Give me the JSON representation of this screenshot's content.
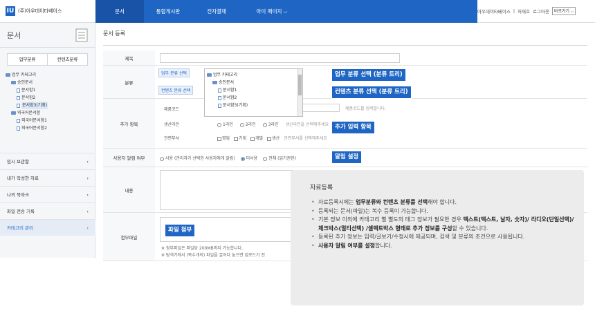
{
  "header": {
    "logo_mark": "IU",
    "logo_text": "(주)아우데이타베이스",
    "nav": [
      "문서",
      "통합게시판",
      "전자결재",
      "마이 페이지 ⌵"
    ],
    "user_company": "아우데이타베이스",
    "user_name": "허재호",
    "logout": "로그아웃",
    "shortcut_select": "바로가기 ⌵"
  },
  "sidebar": {
    "title": "문서",
    "tabs": [
      "업무분류",
      "컨텐츠분류"
    ],
    "tree": [
      {
        "label": "업무 카테고리",
        "type": "folder",
        "indent": 0
      },
      {
        "label": "승인문서",
        "type": "folder",
        "indent": 1
      },
      {
        "label": "문서함1",
        "type": "doc",
        "indent": 2
      },
      {
        "label": "문서함2",
        "type": "doc",
        "indent": 2
      },
      {
        "label": "문서함3(기획)",
        "type": "doc",
        "indent": 2,
        "selected": true
      },
      {
        "label": "외국어문서함",
        "type": "folder",
        "indent": 1
      },
      {
        "label": "외국어문서함1",
        "type": "doc",
        "indent": 2
      },
      {
        "label": "외국어문서함2",
        "type": "doc",
        "indent": 2
      }
    ],
    "menu": [
      "임시 보관함",
      "내가 작성한 자료",
      "나의 북마크",
      "파일 전송 기록",
      "카테고리 관리"
    ]
  },
  "form": {
    "page_title": "문서 등록",
    "labels": {
      "title": "제목",
      "category": "분류",
      "extra": "추가 항목",
      "alarm": "사용자 알림 여부",
      "content": "내용",
      "attach": "첨부파일"
    },
    "category_buttons": [
      "업무 분류 선택",
      "컨텐츠 분류 선택"
    ],
    "category_tree": [
      "업무 카테고리",
      "승인문서",
      "문서함1",
      "문서함2",
      "문서함3(기획)"
    ],
    "extra_fields": {
      "product_code_label": "제품코드",
      "product_code_hint": "제품코드를 입력합니다.",
      "line_label": "생산라인",
      "line_options": [
        "1라인",
        "2라인",
        "3라인"
      ],
      "line_hint": "생산라인을 선택해주세요",
      "dept_label": "관련부서",
      "dept_options": [
        "영업",
        "기획",
        "개발",
        "생산"
      ],
      "dept_hint": "관련부서를 선택해주세요"
    },
    "alarm_options": [
      "사용 (관리자가 선택한 사용자에게 알림)",
      "미사용",
      "전체 (읽기권한)"
    ],
    "attach_notes": [
      "※ 첨부파일은 파일당 200MB까지 가능합니다.",
      "※ 탐색기에서 (복수개의) 파일을 끌어다 놓으면 업로드가 진"
    ]
  },
  "callouts": {
    "cat_tree": "업무 분류 선택 (분류 트리)",
    "content_tree": "컨텐츠 분류 선택 (분류 트리)",
    "extra": "추가 입력 항목",
    "alarm": "알림 설정",
    "attach": "파일 첨부"
  },
  "popup": {
    "title": "자료등록",
    "items": [
      {
        "pre": "자료등록시에는 ",
        "bold": "업무분류와 컨텐츠 분류를 선택",
        "post": "해야 합니다."
      },
      {
        "pre": "등록되는 문서(파일)는 복수 등록이 가능합니다.",
        "bold": "",
        "post": ""
      },
      {
        "pre": "기본 정보 이외에 카테고리 별 별도의 태그 정보가 필요한 경우 ",
        "bold": "텍스트(텍스트, 날자, 숫자)/ 라디오(단일선택)/ 체크박스(멀티선택) /셀렉트박스 형태로 추가 정보를 구성",
        "post": "할 수 있습니다."
      },
      {
        "pre": "등록된 추가 정보는 입력/글보기/수정시에 제공되며, 검색 및 분류의 조건으로 사용됩니다.",
        "bold": "",
        "post": ""
      },
      {
        "pre": "",
        "bold": "사용자 알림 여부를 설정",
        "post": "합니다."
      }
    ]
  },
  "colors": {
    "accent": "#1f66c4",
    "callout": "#1f66c4",
    "popup_bg": "#ececec"
  }
}
